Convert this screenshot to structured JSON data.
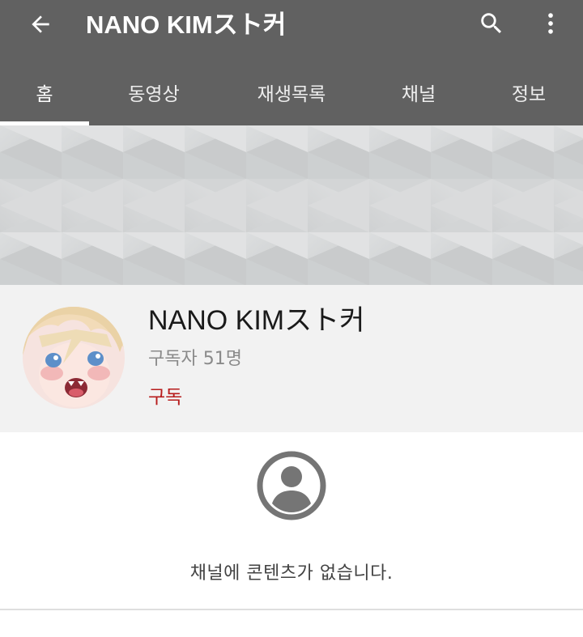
{
  "appbar": {
    "title": "NANO KIMスト커",
    "icons": {
      "back": "arrow-back-icon",
      "search": "search-icon",
      "more": "more-vert-icon"
    },
    "background_color": "#616161"
  },
  "tabs": [
    {
      "label": "홈",
      "active": true
    },
    {
      "label": "동영상",
      "active": false
    },
    {
      "label": "재생목록",
      "active": false
    },
    {
      "label": "채널",
      "active": false
    },
    {
      "label": "정보",
      "active": false
    }
  ],
  "channel": {
    "name": "NANO KIMスト커",
    "subscribers": "구독자 51명",
    "subscribe_label": "구독",
    "subscribe_color": "#b71c1c"
  },
  "empty_state": {
    "icon": "account-circle-icon",
    "message": "채널에 콘텐츠가 없습니다."
  }
}
